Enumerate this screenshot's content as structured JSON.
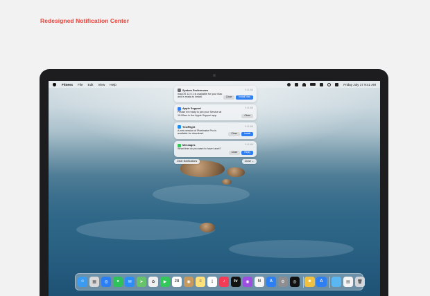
{
  "page": {
    "heading": "Redesigned Notification Center"
  },
  "menubar": {
    "app_name": "Fitness",
    "items": [
      "File",
      "Edit",
      "View",
      "Help"
    ],
    "clock": "Friday July 17  9:41 AM",
    "status_icons": [
      "moon-icon",
      "airplay-icon",
      "wifi-icon",
      "battery-icon",
      "user-icon",
      "search-icon",
      "control-center-icon"
    ]
  },
  "notifications": [
    {
      "app": "System Preferences",
      "time": "9:41 AM",
      "body": "macOS 12.0.1 is available for your Mac and is ready to install.",
      "buttons": [
        "Close",
        "Install Now"
      ],
      "icon": "gear-icon",
      "icon_color": "#6b6b70"
    },
    {
      "app": "Apple Support",
      "time": "9:41 AM",
      "body": "Please be ready to join your Service at 10:00am in the Apple Support app.",
      "buttons": [
        "Close"
      ],
      "icon": "apple-support-icon",
      "icon_color": "#2f7ff2"
    },
    {
      "app": "TestFlight",
      "time": "9:41 AM",
      "body": "A new version of Pixelmator Pro is available for download.",
      "buttons": [
        "Close",
        "Install"
      ],
      "icon": "testflight-icon",
      "icon_color": "#1a8cf0"
    },
    {
      "app": "Messages",
      "time": "9:41 AM",
      "body": "What time do you want to have lunch?",
      "buttons": [
        "Close",
        "Reply"
      ],
      "icon": "message-bubble-icon",
      "icon_color": "#34c759"
    }
  ],
  "footer": {
    "clear_label": "Clear Notifications",
    "close_label": "Close ⌄"
  },
  "dock": {
    "apps": [
      {
        "name": "finder-icon",
        "color": "#3a9bf0",
        "glyph": "☺"
      },
      {
        "name": "launchpad-icon",
        "color": "#d9d9d9",
        "glyph": "▦"
      },
      {
        "name": "safari-icon",
        "color": "#2b7ff2",
        "glyph": "◎"
      },
      {
        "name": "messages-icon",
        "color": "#2fc25b",
        "glyph": "●"
      },
      {
        "name": "mail-icon",
        "color": "#2e8df5",
        "glyph": "✉"
      },
      {
        "name": "maps-icon",
        "color": "#66c36c",
        "glyph": "➤"
      },
      {
        "name": "photos-icon",
        "color": "#f0f0f0",
        "glyph": "✿"
      },
      {
        "name": "facetime-icon",
        "color": "#34c759",
        "glyph": "▶"
      },
      {
        "name": "calendar-icon",
        "color": "#ffffff",
        "glyph": "28"
      },
      {
        "name": "contacts-icon",
        "color": "#c69a5f",
        "glyph": "◉"
      },
      {
        "name": "notes-icon",
        "color": "#ffe07a",
        "glyph": "≡"
      },
      {
        "name": "reminders-icon",
        "color": "#ffffff",
        "glyph": "⋮"
      },
      {
        "name": "music-icon",
        "color": "#f23b55",
        "glyph": "♪"
      },
      {
        "name": "apple-tv-icon",
        "color": "#111111",
        "glyph": "tv"
      },
      {
        "name": "podcasts-icon",
        "color": "#9b4ee0",
        "glyph": "◉"
      },
      {
        "name": "news-icon",
        "color": "#f4f4f4",
        "glyph": "N"
      },
      {
        "name": "app-store-icon",
        "color": "#2d7ff2",
        "glyph": "A"
      },
      {
        "name": "system-preferences-icon",
        "color": "#8d8d92",
        "glyph": "⚙"
      },
      {
        "name": "fitness-icon",
        "color": "#111111",
        "glyph": "◎"
      },
      {
        "name": "memoji-icon",
        "color": "#f0c040",
        "glyph": "☻"
      },
      {
        "name": "app-store-2-icon",
        "color": "#2d7ff2",
        "glyph": "A"
      },
      {
        "name": "folder-icon",
        "color": "#5bb7f2",
        "glyph": ""
      },
      {
        "name": "document-icon",
        "color": "#f4f4f4",
        "glyph": "▤"
      },
      {
        "name": "trash-icon",
        "color": "#d3d7db",
        "glyph": "🗑"
      }
    ]
  }
}
